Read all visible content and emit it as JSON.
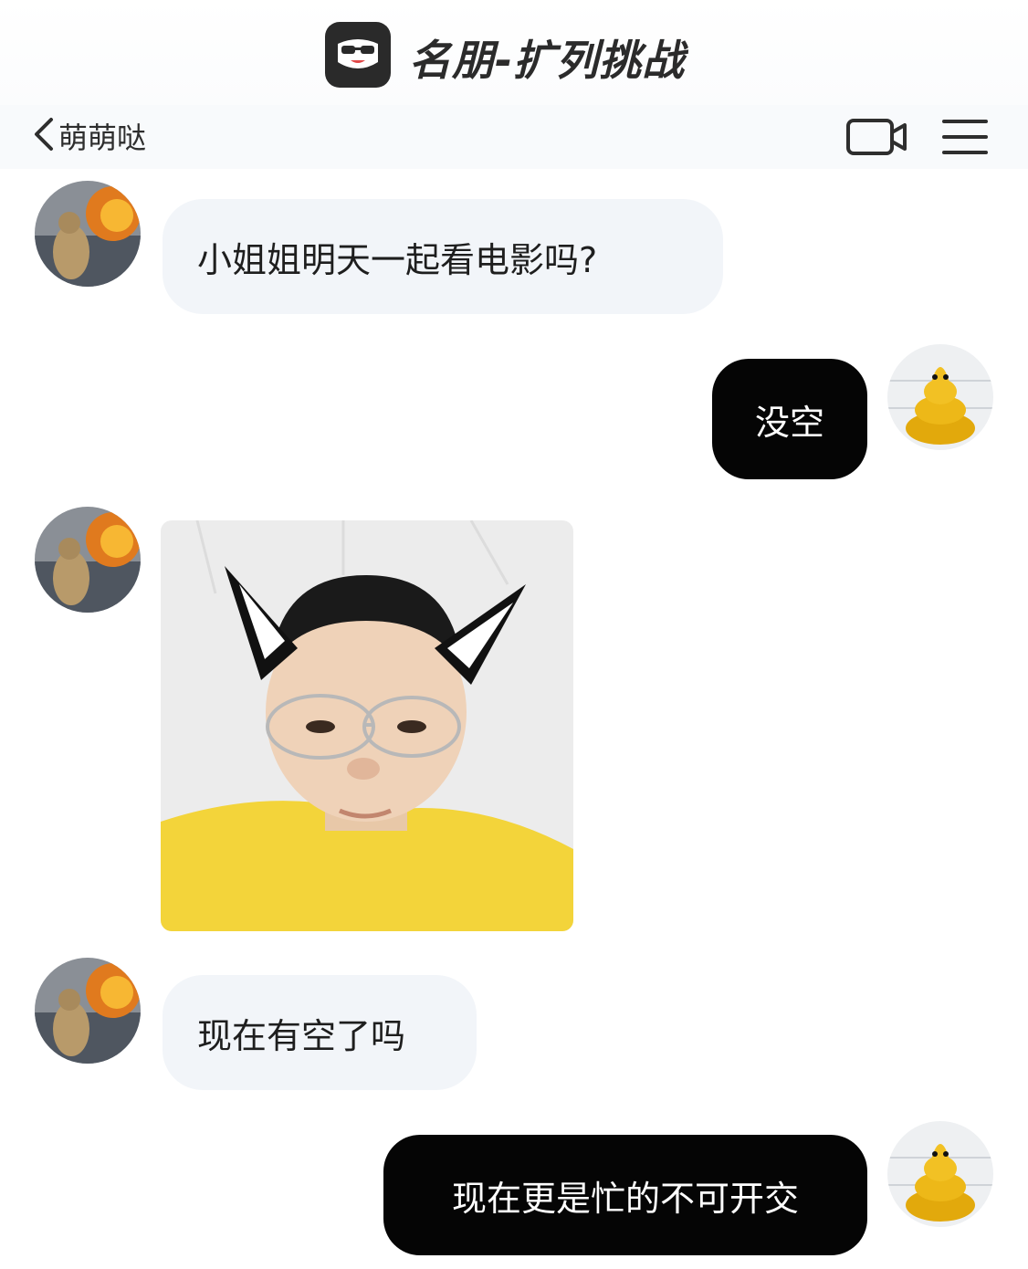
{
  "header": {
    "brand_title": "名朋-扩列挑战",
    "logo_icon": "sunglasses-face-icon"
  },
  "nav": {
    "back_icon": "chevron-left-icon",
    "contact_name": "萌萌哒",
    "video_icon": "video-camera-icon",
    "menu_icon": "hamburger-menu-icon"
  },
  "messages": [
    {
      "side": "left",
      "type": "text",
      "text": "小姐姐明天一起看电影吗?"
    },
    {
      "side": "right",
      "type": "text",
      "text": "没空"
    },
    {
      "side": "left",
      "type": "image",
      "description_icon": "cat-ear-selfie-photo"
    },
    {
      "side": "left",
      "type": "text",
      "text": "现在有空了吗"
    },
    {
      "side": "right",
      "type": "text",
      "text": "现在更是忙的不可开交"
    }
  ],
  "colors": {
    "incoming_bubble": "#f2f5f9",
    "outgoing_bubble": "#050505",
    "outgoing_text": "#ffffff"
  }
}
